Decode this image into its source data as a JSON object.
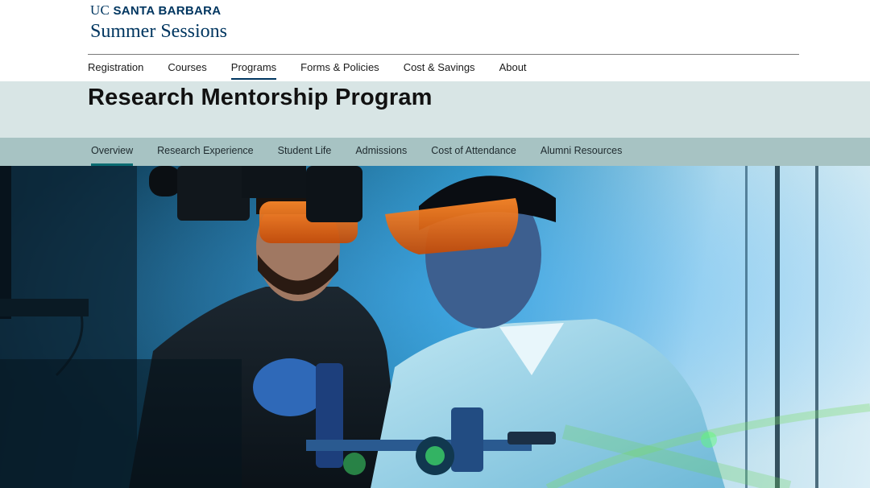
{
  "brand": {
    "line1_uc": "UC",
    "line1_name": "SANTA BARBARA",
    "line2": "Summer Sessions",
    "color": "#003660"
  },
  "primary_nav": {
    "items": [
      {
        "label": "Registration",
        "active": false
      },
      {
        "label": "Courses",
        "active": false
      },
      {
        "label": "Programs",
        "active": true
      },
      {
        "label": "Forms & Policies",
        "active": false
      },
      {
        "label": "Cost & Savings",
        "active": false
      },
      {
        "label": "About",
        "active": false
      }
    ]
  },
  "page": {
    "title": "Research Mentorship Program",
    "band_color": "#d8e5e5"
  },
  "sub_nav": {
    "color": "#a7c3c3",
    "accent": "#0b6c72",
    "items": [
      {
        "label": "Overview",
        "active": true
      },
      {
        "label": "Research Experience",
        "active": false
      },
      {
        "label": "Student Life",
        "active": false
      },
      {
        "label": "Admissions",
        "active": false
      },
      {
        "label": "Cost of Attendance",
        "active": false
      },
      {
        "label": "Alumni Resources",
        "active": false
      }
    ]
  },
  "hero": {
    "icon": "lab-photo"
  }
}
